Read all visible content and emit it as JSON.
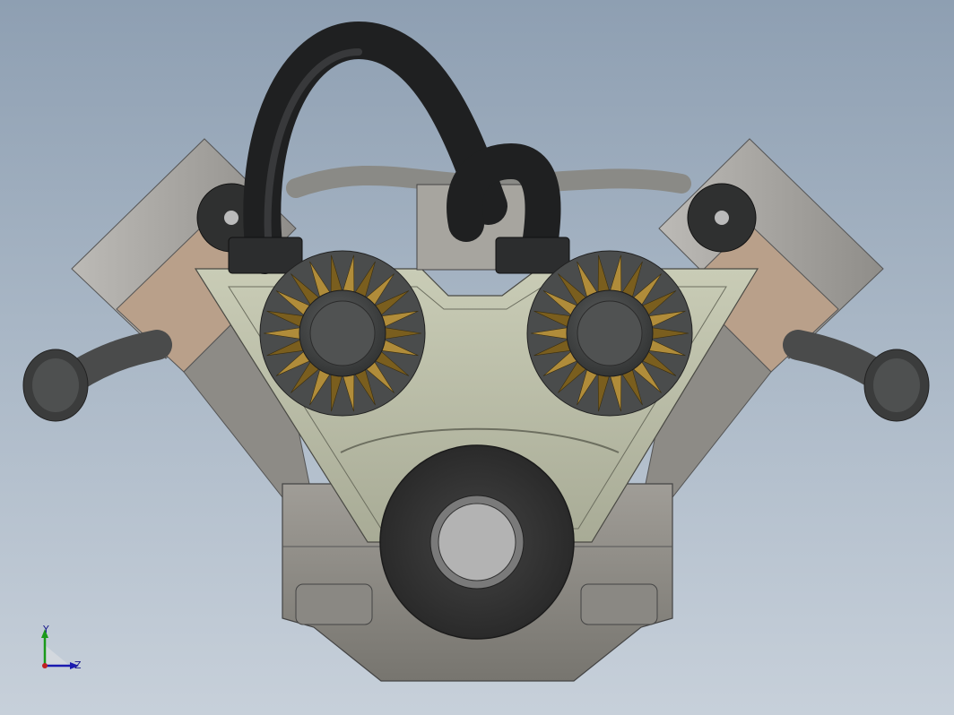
{
  "viewport": {
    "background_top": "#8e9fb2",
    "background_bottom": "#c7d0da"
  },
  "model": {
    "colors": {
      "housing": "#8f8c86",
      "housing_dark": "#6e6c68",
      "cover_plate": "#b9bca6",
      "cover_plate_light": "#cdd0bc",
      "cylinder": "#a6a4a0",
      "copper_band": "#b9a08a",
      "hose": "#2e2f30",
      "gear": "#b08c3a",
      "gear_dark": "#7a5e1e",
      "hub": "#4a4c4c",
      "bearing": "#3a3a3a"
    }
  },
  "triad": {
    "y_label": "Y",
    "z_label": "Z",
    "y_color": "#1a9a1a",
    "z_color": "#1a1ab0",
    "origin_color": "#c02020"
  }
}
